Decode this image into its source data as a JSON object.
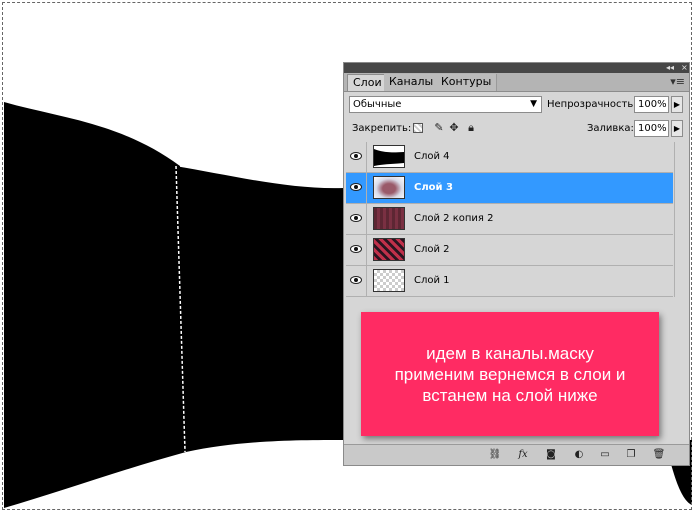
{
  "tabs": [
    {
      "label": "Слои",
      "active": true
    },
    {
      "label": "Каналы",
      "active": false
    },
    {
      "label": "Контуры",
      "active": false
    }
  ],
  "blend_mode": "Обычные",
  "opacity_label": "Непрозрачность:",
  "opacity_value": "100%",
  "lock_label": "Закрепить:",
  "fill_label": "Заливка:",
  "fill_value": "100%",
  "layers": [
    {
      "name": "Слой 4",
      "visible": true,
      "selected": false
    },
    {
      "name": "Слой 3",
      "visible": true,
      "selected": true
    },
    {
      "name": "Слой 2 копия 2",
      "visible": true,
      "selected": false
    },
    {
      "name": "Слой 2",
      "visible": true,
      "selected": false
    },
    {
      "name": "Слой 1",
      "visible": true,
      "selected": false
    }
  ],
  "annotation": {
    "line1": "идем в каналы.маску",
    "line2": "применим вернемся в слои и",
    "line3": "встанем на слой ниже"
  },
  "colors": {
    "selection": "#3399ff",
    "annotation_bg": "#ff2b63",
    "panel_bg": "#d6d6d6"
  },
  "bottom_icons": [
    "link-icon",
    "fx-icon",
    "mask-icon",
    "adjustment-icon",
    "group-icon",
    "new-layer-icon",
    "trash-icon"
  ]
}
